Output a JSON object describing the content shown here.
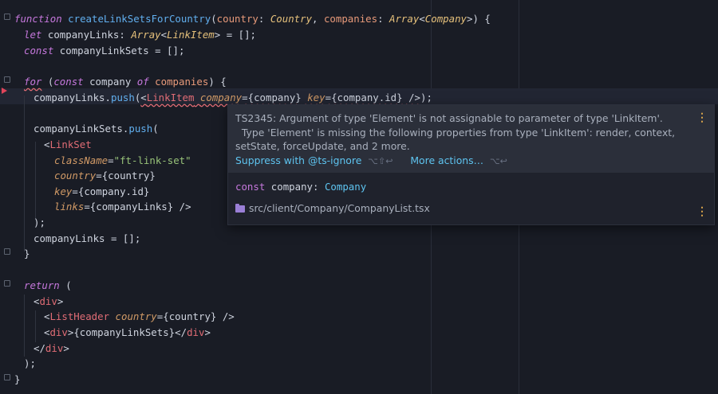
{
  "code": {
    "l1": {
      "kw": "function",
      "fn": "createLinkSetsForCountry",
      "p1": "country",
      "t1": "Country",
      "p2": "companies",
      "t2a": "Array",
      "t2b": "Company",
      "tail": ">) {"
    },
    "l2": {
      "kw": "let",
      "name": "companyLinks",
      "ty": "Array",
      "ty2": "LinkItem",
      "rest": "> = [];"
    },
    "l3": {
      "kw": "const",
      "rest": "companyLinkSets = [];"
    },
    "l5": {
      "kw": "for",
      "kw2": "const",
      "kw3": "of",
      "v": "companies",
      "mid": "company",
      "tail": ") {"
    },
    "l6": {
      "obj": "companyLinks.",
      "fn": "push",
      "tag": "LinkItem",
      "a1": "company",
      "a1v": "{company}",
      "a2": "key",
      "a2v": "{company.id}",
      "tail": " />);"
    },
    "l8": {
      "obj": "companyLinkSets.",
      "fn": "push",
      "tail": "("
    },
    "l9": {
      "tag": "LinkSet"
    },
    "l10": {
      "attr": "className",
      "val": "\"ft-link-set\""
    },
    "l11": {
      "attr": "country",
      "val": "{country}"
    },
    "l12": {
      "attr": "key",
      "val": "{company.id}"
    },
    "l13": {
      "attr": "links",
      "val": "{companyLinks} />"
    },
    "l14": ");",
    "l15": "companyLinks = [];",
    "l16": "}",
    "l18": {
      "kw": "return",
      "rest": " ("
    },
    "l19": {
      "tag": "div"
    },
    "l20": {
      "tag": "ListHeader",
      "attr": "country",
      "val": "{country} />"
    },
    "l21": {
      "tag": "div",
      "mid": "{companyLinkSets}</",
      "tag2": "div"
    },
    "l22": {
      "tag": "div"
    },
    "l23": ");",
    "l24": "}"
  },
  "popup": {
    "message": "TS2345: Argument of type 'Element' is not assignable to parameter of type 'LinkItem'.\n  Type 'Element' is missing the following properties from type 'LinkItem': render, context,\nsetState, forceUpdate, and 2 more.",
    "action1": "Suppress with @ts-ignore",
    "shortcut1": "⌥⇧↩",
    "action2": "More actions…",
    "shortcut2": "⌥↩",
    "sig_kw": "const",
    "sig_name": "company:",
    "sig_type": "Company",
    "path": "src/client/Company/CompanyList.tsx",
    "kebab": "⋮"
  }
}
